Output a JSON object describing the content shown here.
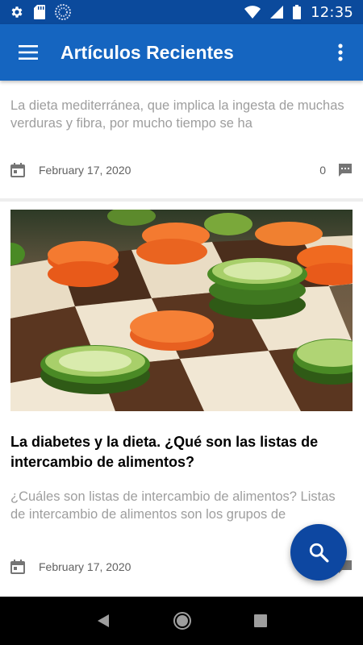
{
  "status_bar": {
    "time": "12:35",
    "icons": [
      "gear-icon",
      "sd-card-icon",
      "sync-circle-icon",
      "wifi-icon",
      "cell-signal-icon",
      "battery-icon"
    ]
  },
  "app_bar": {
    "title": "Artículos Recientes",
    "menu_icon": "hamburger-menu-icon",
    "overflow_icon": "more-vertical-icon"
  },
  "articles": [
    {
      "excerpt": "La dieta mediterránea, que implica la ingesta de muchas verduras y fibra, por mucho tiempo se ha",
      "date": "February 17, 2020",
      "comments": "0"
    },
    {
      "image": "carrot-cucumber-chessboard-photo",
      "title": "La diabetes y la dieta. ¿Qué son las listas de intercambio de alimentos?",
      "excerpt": "¿Cuáles son listas de intercambio de alimentos? Listas de intercambio de alimentos son los grupos de",
      "date": "February 17, 2020"
    }
  ],
  "fab": {
    "icon": "search-icon"
  },
  "nav_bar": {
    "icons": [
      "back-icon",
      "home-icon",
      "recents-icon"
    ]
  },
  "colors": {
    "status_bar": "#0b4a9c",
    "app_bar": "#1565c0",
    "fab": "#0d47a1",
    "background": "#eeeeee"
  }
}
